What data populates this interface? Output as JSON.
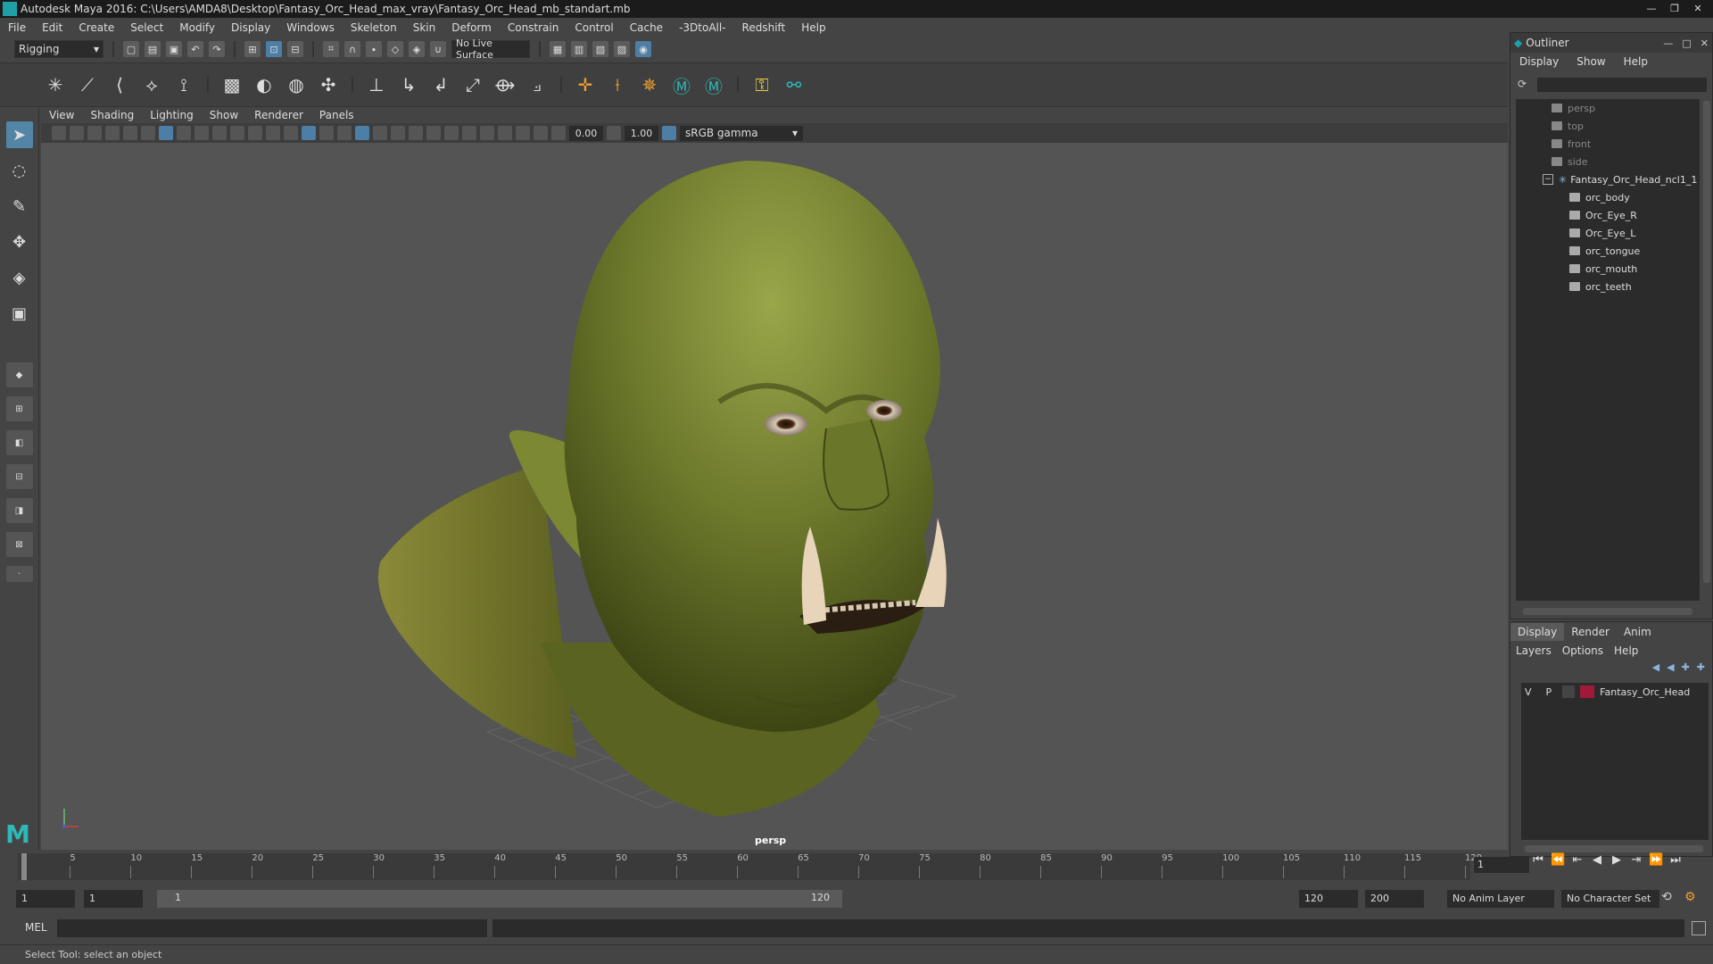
{
  "window": {
    "title": "Autodesk Maya 2016: C:\\Users\\AMDA8\\Desktop\\Fantasy_Orc_Head_max_vray\\Fantasy_Orc_Head_mb_standart.mb"
  },
  "menubar": [
    "File",
    "Edit",
    "Create",
    "Select",
    "Modify",
    "Display",
    "Windows",
    "Skeleton",
    "Skin",
    "Deform",
    "Constrain",
    "Control",
    "Cache",
    "-3DtoAll-",
    "Redshift",
    "Help"
  ],
  "toolbar": {
    "menu_set": "Rigging",
    "live_surface": "No Live Surface"
  },
  "panel": {
    "menu": [
      "View",
      "Shading",
      "Lighting",
      "Show",
      "Renderer",
      "Panels"
    ],
    "exposure": "0.00",
    "gamma": "1.00",
    "color_space": "sRGB gamma",
    "camera_label": "persp"
  },
  "outliner": {
    "title": "Outliner",
    "menu": [
      "Display",
      "Show",
      "Help"
    ],
    "cameras": [
      "persp",
      "top",
      "front",
      "side"
    ],
    "group": "Fantasy_Orc_Head_ncl1_1",
    "meshes": [
      "orc_body",
      "Orc_Eye_R",
      "Orc_Eye_L",
      "orc_tongue",
      "orc_mouth",
      "orc_teeth"
    ]
  },
  "layer_editor": {
    "tabs": [
      "Display",
      "Render",
      "Anim"
    ],
    "active_tab": "Display",
    "menu": [
      "Layers",
      "Options",
      "Help"
    ],
    "layers": [
      {
        "v": "V",
        "p": "P",
        "name": "Fantasy_Orc_Head",
        "color": "#a0183a"
      }
    ]
  },
  "timeline": {
    "ticks": [
      "1",
      "5",
      "10",
      "15",
      "20",
      "25",
      "30",
      "35",
      "40",
      "45",
      "50",
      "55",
      "60",
      "65",
      "70",
      "75",
      "80",
      "85",
      "90",
      "95",
      "100",
      "105",
      "110",
      "115",
      "120"
    ],
    "current_frame": "1"
  },
  "range": {
    "start": "1",
    "anim_start": "1",
    "slider_start": "1",
    "slider_end": "120",
    "playback_end": "120",
    "anim_end": "200",
    "anim_layer": "No Anim Layer",
    "char_set": "No Character Set"
  },
  "command_line": {
    "label": "MEL"
  },
  "status_line": "Select Tool: select an object",
  "colors": {
    "accent": "#5285a6",
    "maya_teal": "#1fa0a8",
    "orc_skin": "#6b7a2a"
  }
}
